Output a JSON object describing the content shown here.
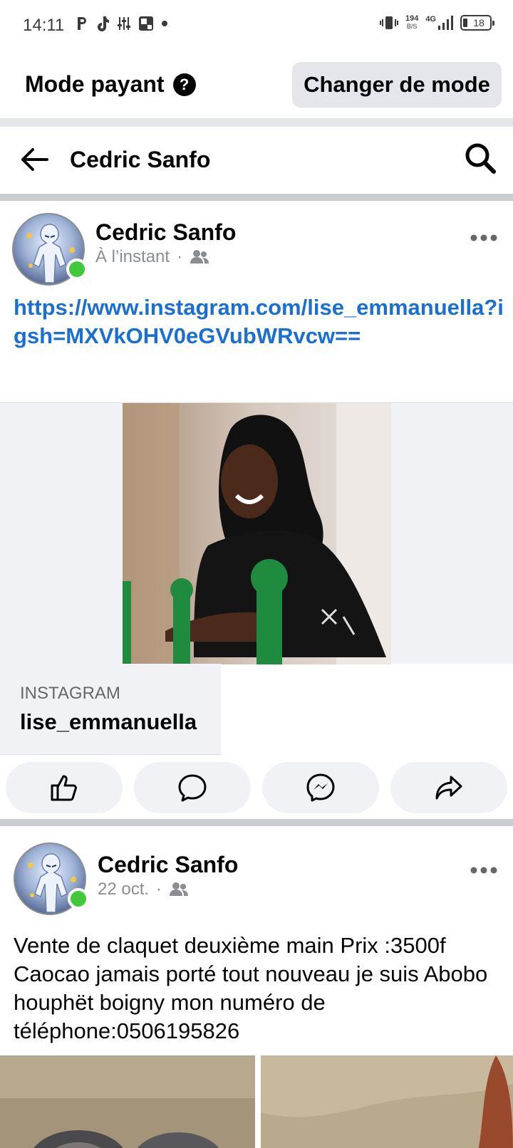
{
  "status_bar": {
    "time": "14:11",
    "net_speed_value": "194",
    "net_speed_unit": "B/S",
    "network": "4G",
    "battery": "18"
  },
  "mode_bar": {
    "title": "Mode payant",
    "help_glyph": "?",
    "change_mode_label": "Changer de mode"
  },
  "header": {
    "title": "Cedric Sanfo"
  },
  "posts": [
    {
      "author": "Cedric Sanfo",
      "time": "À l’instant",
      "audience_icon": "friends-icon",
      "link_url": "https://www.instagram.com/lise_emmanuella?igsh=MXVkOHV0eGVubWRvcw==",
      "link_card": {
        "domain": "INSTAGRAM",
        "title": "lise_emmanuella"
      }
    },
    {
      "author": "Cedric Sanfo",
      "time": "22 oct.",
      "audience_icon": "friends-icon",
      "text": "Vente de claquet deuxième main Prix :3500f Caocao jamais porté tout nouveau je suis Abobo houphët boigny mon numéro de téléphone:0506195826"
    }
  ],
  "actions": [
    "like-icon",
    "comment-icon",
    "messenger-icon",
    "share-icon"
  ],
  "colors": {
    "link": "#1a6fd1",
    "online": "#42c83b",
    "button_bg": "#e4e6eb",
    "separator": "#c9ccd1"
  }
}
